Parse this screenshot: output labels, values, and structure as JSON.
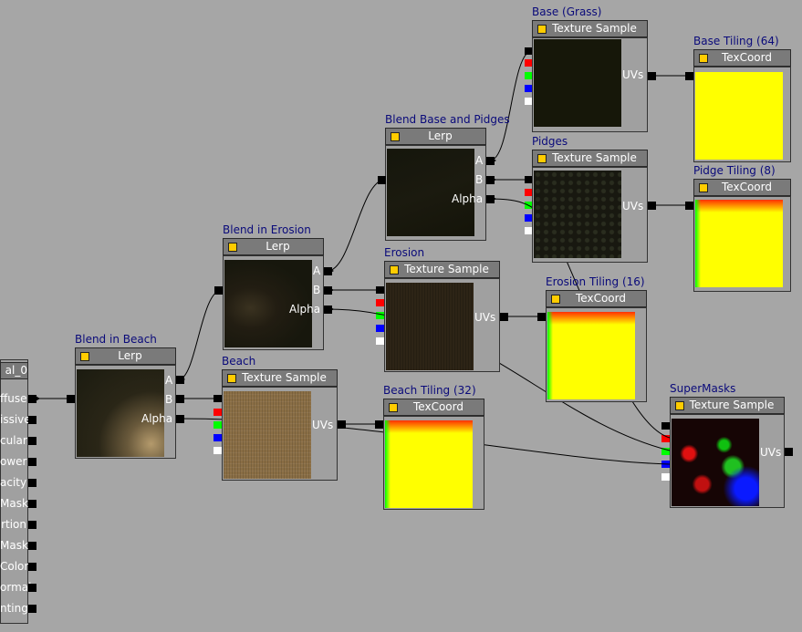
{
  "material": {
    "title_fragment": "al_0",
    "inputs": [
      "ffuse",
      "issive",
      "cular",
      "ower",
      "acity",
      "Mask",
      "rtion",
      "Mask",
      "Color",
      "ormal",
      "nting"
    ]
  },
  "nodes": {
    "base_grass": {
      "caption": "Base (Grass)",
      "header": "Texture Sample",
      "output": "UVs"
    },
    "base_tiling": {
      "caption": "Base Tiling (64)",
      "header": "TexCoord"
    },
    "blend_base_pidges": {
      "caption": "Blend Base and Pidges",
      "header": "Lerp",
      "pins": [
        "A",
        "B",
        "Alpha"
      ]
    },
    "pidges": {
      "caption": "Pidges",
      "header": "Texture Sample",
      "output": "UVs"
    },
    "pidge_tiling": {
      "caption": "Pidge Tiling (8)",
      "header": "TexCoord"
    },
    "blend_erosion": {
      "caption": "Blend in Erosion",
      "header": "Lerp",
      "pins": [
        "A",
        "B",
        "Alpha"
      ]
    },
    "erosion": {
      "caption": "Erosion",
      "header": "Texture Sample",
      "output": "UVs"
    },
    "erosion_tiling": {
      "caption": "Erosion Tiling (16)",
      "header": "TexCoord"
    },
    "blend_beach": {
      "caption": "Blend in Beach",
      "header": "Lerp",
      "pins": [
        "A",
        "B",
        "Alpha"
      ]
    },
    "beach": {
      "caption": "Beach",
      "header": "Texture Sample",
      "output": "UVs"
    },
    "beach_tiling": {
      "caption": "Beach Tiling (32)",
      "header": "TexCoord"
    },
    "supermasks": {
      "caption": "SuperMasks",
      "header": "Texture Sample",
      "output": "UVs"
    }
  },
  "colors": {
    "canvas": "#a6a6a6",
    "caption_text": "#0a0a7a",
    "header": "#7a7a7a",
    "wire": "#000000",
    "channel_r": "#ff0000",
    "channel_g": "#00ff00",
    "channel_b": "#0000ff",
    "channel_a": "#ffffff"
  }
}
